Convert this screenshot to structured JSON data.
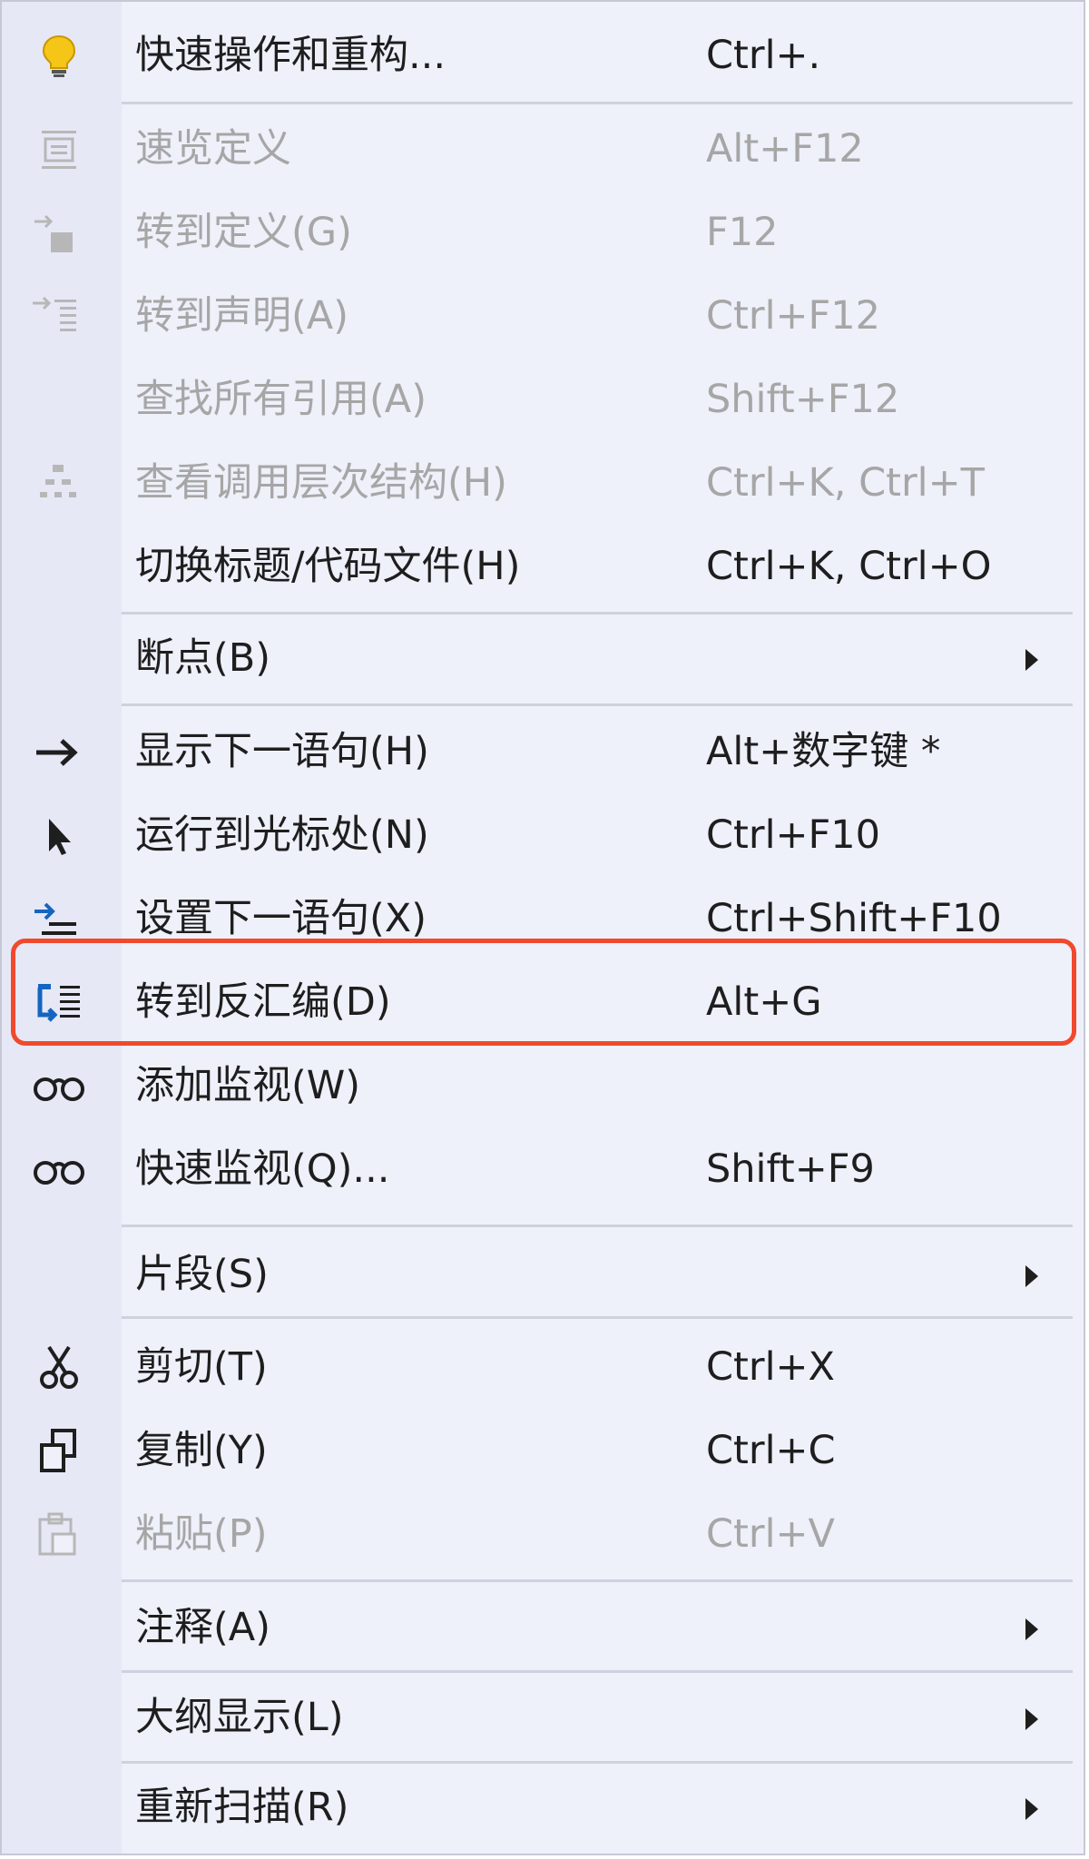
{
  "menu": {
    "items": [
      {
        "label": "快速操作和重构...",
        "shortcut": "Ctrl+.",
        "icon": "lightbulb-icon",
        "disabled": false
      },
      {
        "label": "速览定义",
        "shortcut": "Alt+F12",
        "icon": "peek-definition-icon",
        "disabled": true
      },
      {
        "label": "转到定义(G)",
        "shortcut": "F12",
        "icon": "go-to-definition-icon",
        "disabled": true
      },
      {
        "label": "转到声明(A)",
        "shortcut": "Ctrl+F12",
        "icon": "go-to-declaration-icon",
        "disabled": true
      },
      {
        "label": "查找所有引用(A)",
        "shortcut": "Shift+F12",
        "icon": "",
        "disabled": true
      },
      {
        "label": "查看调用层次结构(H)",
        "shortcut": "Ctrl+K, Ctrl+T",
        "icon": "call-hierarchy-icon",
        "disabled": true
      },
      {
        "label": "切换标题/代码文件(H)",
        "shortcut": "Ctrl+K, Ctrl+O",
        "icon": "",
        "disabled": false
      },
      {
        "label": "断点(B)",
        "shortcut": "",
        "icon": "",
        "disabled": false,
        "submenu": true
      },
      {
        "label": "显示下一语句(H)",
        "shortcut": "Alt+数字键 *",
        "icon": "arrow-right-icon",
        "disabled": false
      },
      {
        "label": "运行到光标处(N)",
        "shortcut": "Ctrl+F10",
        "icon": "cursor-icon",
        "disabled": false
      },
      {
        "label": "设置下一语句(X)",
        "shortcut": "Ctrl+Shift+F10",
        "icon": "set-next-statement-icon",
        "disabled": false
      },
      {
        "label": "转到反汇编(D)",
        "shortcut": "Alt+G",
        "icon": "disassembly-icon",
        "disabled": false,
        "highlighted": true
      },
      {
        "label": "添加监视(W)",
        "shortcut": "",
        "icon": "glasses-icon",
        "disabled": false
      },
      {
        "label": "快速监视(Q)...",
        "shortcut": "Shift+F9",
        "icon": "glasses-icon",
        "disabled": false
      },
      {
        "label": "片段(S)",
        "shortcut": "",
        "icon": "",
        "disabled": false,
        "submenu": true
      },
      {
        "label": "剪切(T)",
        "shortcut": "Ctrl+X",
        "icon": "scissors-icon",
        "disabled": false
      },
      {
        "label": "复制(Y)",
        "shortcut": "Ctrl+C",
        "icon": "copy-icon",
        "disabled": false
      },
      {
        "label": "粘贴(P)",
        "shortcut": "Ctrl+V",
        "icon": "paste-icon",
        "disabled": true
      },
      {
        "label": "注释(A)",
        "shortcut": "",
        "icon": "",
        "disabled": false,
        "submenu": true
      },
      {
        "label": "大纲显示(L)",
        "shortcut": "",
        "icon": "",
        "disabled": false,
        "submenu": true
      },
      {
        "label": "重新扫描(R)",
        "shortcut": "",
        "icon": "",
        "disabled": false,
        "submenu": true
      }
    ]
  },
  "colors": {
    "menu_background": "#eef0fa",
    "icon_gutter": "#e6e8f6",
    "text": "#1e1e1e",
    "disabled_text": "#a6a6a6",
    "separator": "#cfd1df",
    "highlight_border": "#f0492e",
    "icon_blue": "#1565c0",
    "lightbulb_yellow": "#f5c518"
  }
}
